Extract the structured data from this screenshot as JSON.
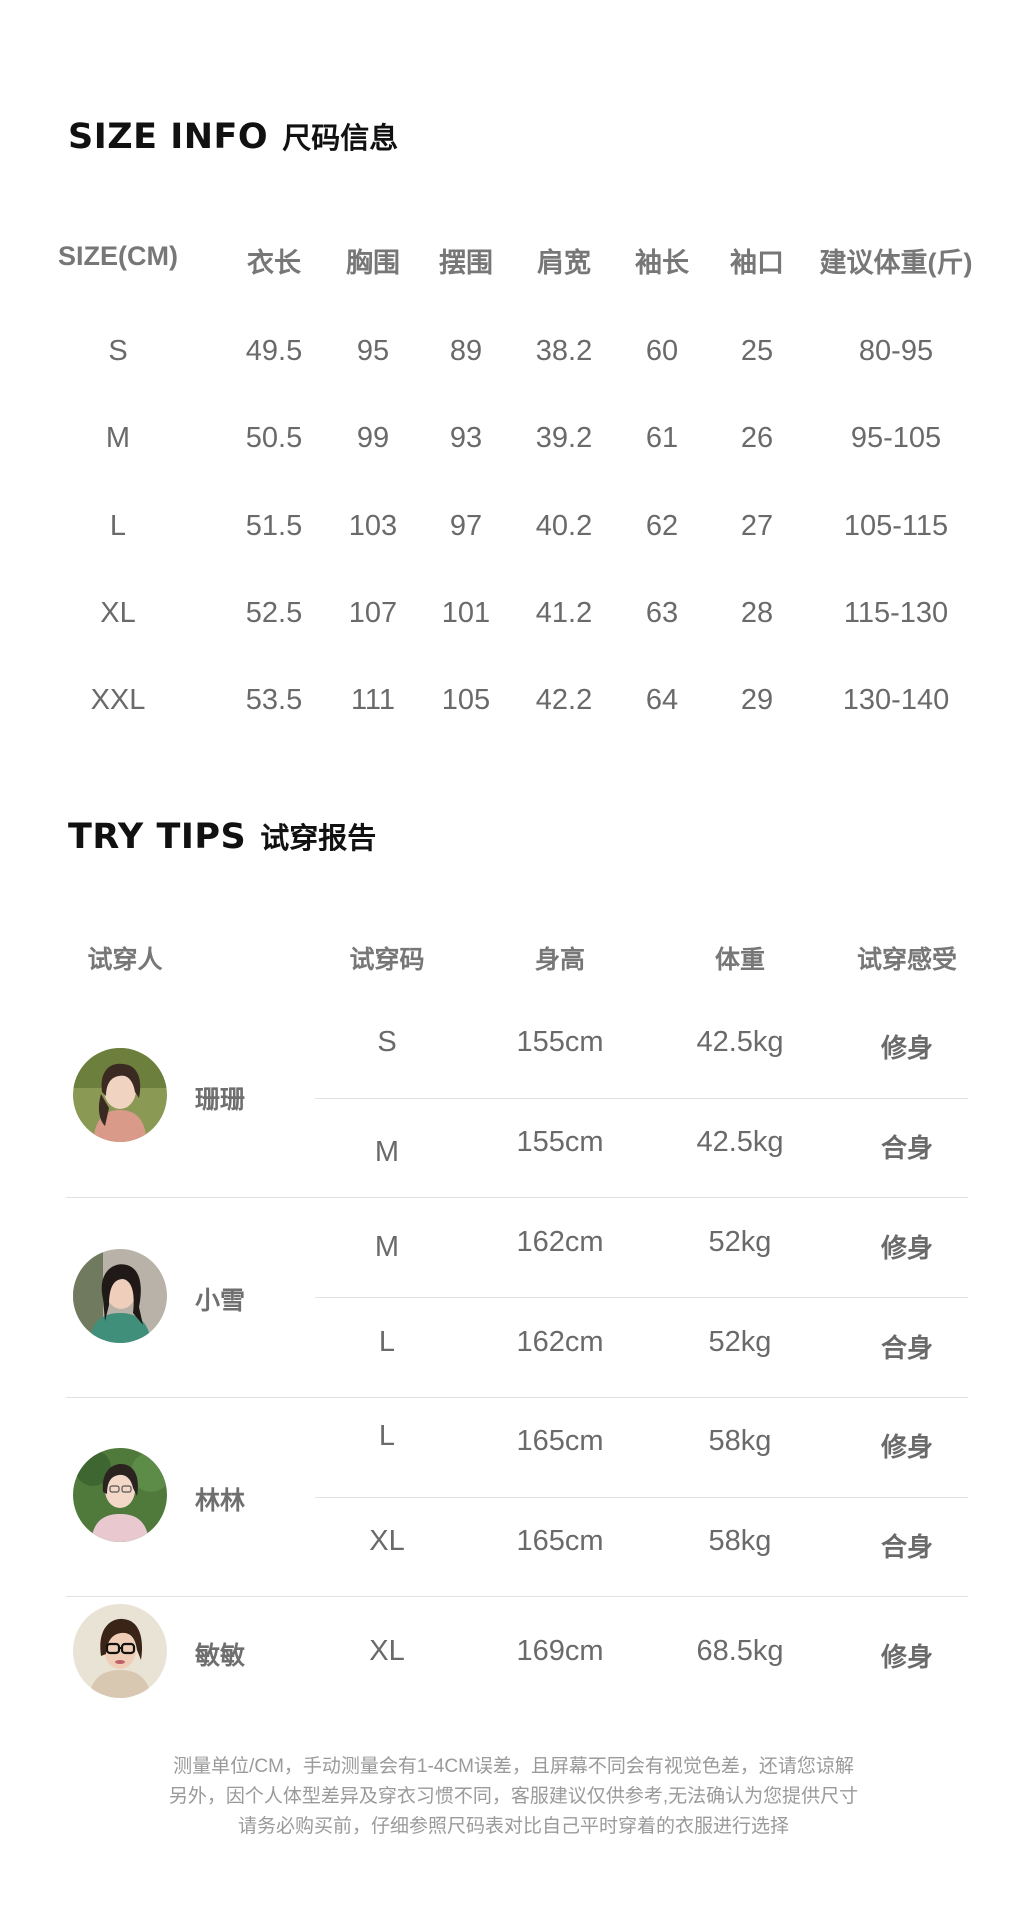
{
  "size_section": {
    "title_en": "SIZE INFO",
    "title_zh": "尺码信息",
    "headers": [
      "SIZE(CM)",
      "衣长",
      "胸围",
      "摆围",
      "肩宽",
      "袖长",
      "袖口",
      "建议体重(斤)"
    ],
    "rows": [
      [
        "S",
        "49.5",
        "95",
        "89",
        "38.2",
        "60",
        "25",
        "80-95"
      ],
      [
        "M",
        "50.5",
        "99",
        "93",
        "39.2",
        "61",
        "26",
        "95-105"
      ],
      [
        "L",
        "51.5",
        "103",
        "97",
        "40.2",
        "62",
        "27",
        "105-115"
      ],
      [
        "XL",
        "52.5",
        "107",
        "101",
        "41.2",
        "63",
        "28",
        "115-130"
      ],
      [
        "XXL",
        "53.5",
        "111",
        "105",
        "42.2",
        "64",
        "29",
        "130-140"
      ]
    ]
  },
  "try_section": {
    "title_en": "TRY TIPS",
    "title_zh": "试穿报告",
    "headers": [
      "试穿人",
      "试穿码",
      "身高",
      "体重",
      "试穿感受"
    ],
    "testers": [
      {
        "name": "珊珊",
        "avatar": "avatar-shanshan",
        "fittings": [
          {
            "size": "S",
            "height": "155cm",
            "weight": "42.5kg",
            "feel": "修身"
          },
          {
            "size": "M",
            "height": "155cm",
            "weight": "42.5kg",
            "feel": "合身"
          }
        ]
      },
      {
        "name": "小雪",
        "avatar": "avatar-xiaoxue",
        "fittings": [
          {
            "size": "M",
            "height": "162cm",
            "weight": "52kg",
            "feel": "修身"
          },
          {
            "size": "L",
            "height": "162cm",
            "weight": "52kg",
            "feel": "合身"
          }
        ]
      },
      {
        "name": "林林",
        "avatar": "avatar-linlin",
        "fittings": [
          {
            "size": "L",
            "height": "165cm",
            "weight": "58kg",
            "feel": "修身"
          },
          {
            "size": "XL",
            "height": "165cm",
            "weight": "58kg",
            "feel": "合身"
          }
        ]
      },
      {
        "name": "敏敏",
        "avatar": "avatar-minmin",
        "fittings": [
          {
            "size": "XL",
            "height": "169cm",
            "weight": "68.5kg",
            "feel": "修身"
          }
        ]
      }
    ]
  },
  "footnote": [
    "测量单位/CM，手动测量会有1-4CM误差，且屏幕不同会有视觉色差，还请您谅解",
    "另外，因个人体型差异及穿衣习惯不同，客服建议仅供参考,无法确认为您提供尺寸",
    "请务必购买前，仔细参照尺码表对比自己平时穿着的衣服进行选择"
  ]
}
